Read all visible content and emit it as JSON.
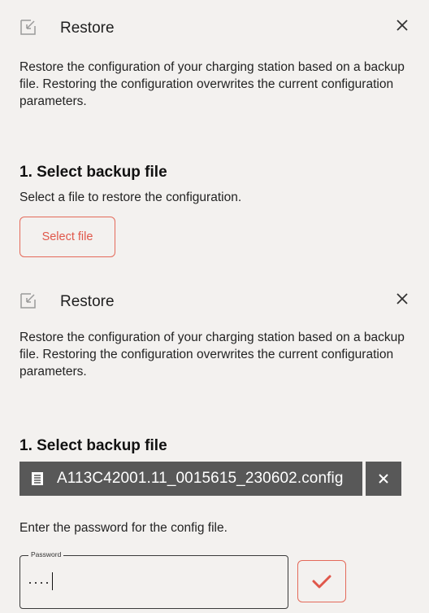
{
  "dialogs": [
    {
      "title": "Restore",
      "description": "Restore the configuration of your charging station based on a backup file. Restoring the configuration overwrites the current configuration parameters.",
      "step_title": "1. Select backup file",
      "step_hint": "Select a file to restore the configuration.",
      "select_button_label": "Select file"
    },
    {
      "title": "Restore",
      "description": "Restore the configuration of your charging station based on a backup file. Restoring the configuration overwrites the current configuration parameters.",
      "step_title": "1. Select backup file",
      "selected_file": "A113C42001.11_0015615_230602.config",
      "password_prompt": "Enter the password for the config file.",
      "password_label": "Password",
      "password_value": "····"
    }
  ],
  "colors": {
    "background": "#f3f1ef",
    "accent": "#e0574a",
    "chip": "#585858"
  },
  "icons": {
    "header": "restore-import-icon",
    "close": "close-icon",
    "file": "file-icon",
    "remove": "remove-file-icon",
    "confirm": "checkmark-icon"
  }
}
